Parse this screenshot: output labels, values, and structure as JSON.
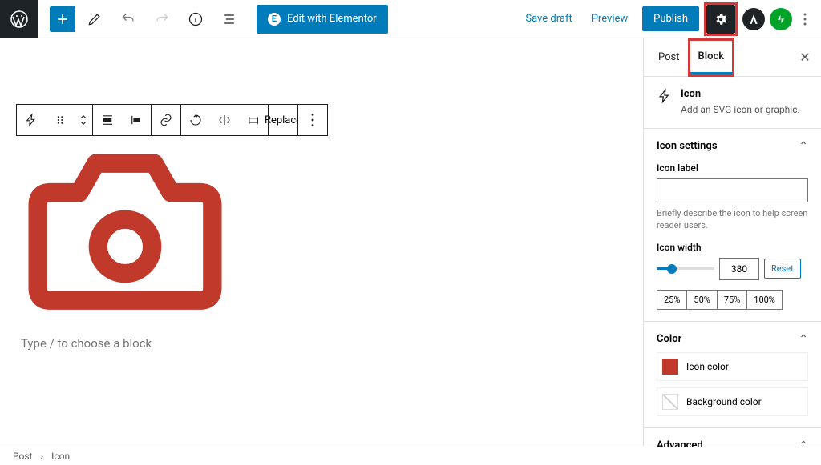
{
  "topbar": {
    "elementor_label": "Edit with Elementor",
    "save_draft": "Save draft",
    "preview": "Preview",
    "publish": "Publish"
  },
  "toolbar": {
    "replace_label": "Replace"
  },
  "editor": {
    "prompt": "Type / to choose a block"
  },
  "sidebar": {
    "tabs": {
      "post": "Post",
      "block": "Block"
    },
    "block_summary": {
      "name": "Icon",
      "desc": "Add an SVG icon or graphic."
    },
    "icon_settings": {
      "title": "Icon settings",
      "label_field": "Icon label",
      "label_value": "",
      "label_help": "Briefly describe the icon to help screen reader users.",
      "width_label": "Icon width",
      "width_value": "380",
      "reset": "Reset",
      "presets": [
        "25%",
        "50%",
        "75%",
        "100%"
      ]
    },
    "color": {
      "title": "Color",
      "icon_color": "Icon color",
      "bg_color": "Background color",
      "icon_color_hex": "#c0392b"
    },
    "advanced": {
      "title": "Advanced"
    }
  },
  "breadcrumb": {
    "root": "Post",
    "current": "Icon"
  }
}
